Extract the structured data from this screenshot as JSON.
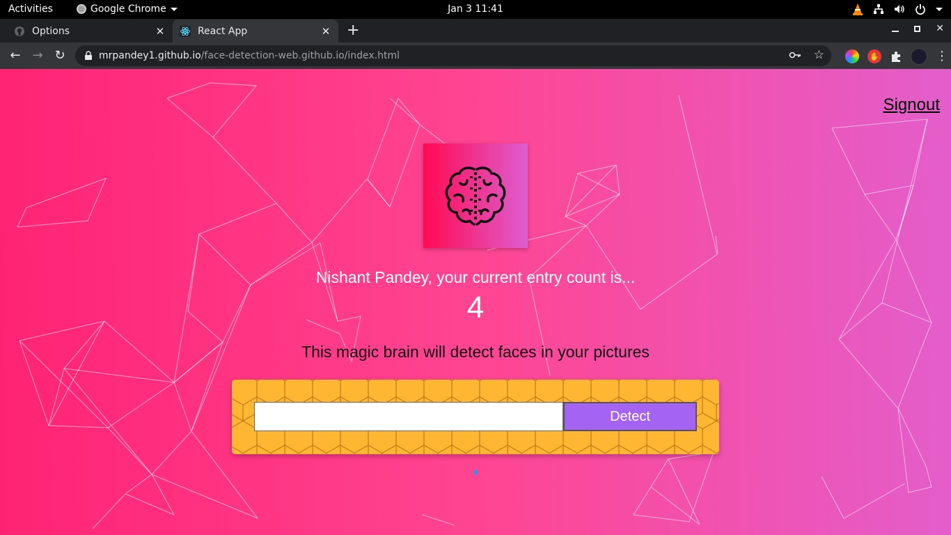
{
  "system_bar": {
    "activities": "Activities",
    "app_menu": "Google Chrome",
    "clock": "Jan 3  11:41",
    "tray_icons": [
      "vlc-icon",
      "network-icon",
      "volume-icon",
      "power-icon"
    ]
  },
  "browser": {
    "tabs": [
      {
        "title": "Options",
        "icon": "github-icon",
        "active": false
      },
      {
        "title": "React App",
        "icon": "react-icon",
        "active": true
      }
    ],
    "address": {
      "host": "mrpandey1.github.io",
      "path": "/face-detection-web.github.io/index.html"
    },
    "extensions": [
      "color-wheel-extension-icon",
      "stop-hand-extension-icon",
      "puzzle-extensions-icon"
    ]
  },
  "page": {
    "signout": "Signout",
    "entry_text": "Nishant Pandey, your current entry count is...",
    "entry_count": "4",
    "tagline": "This magic brain will detect faces in your pictures",
    "input_value": "",
    "detect_label": "Detect"
  },
  "colors": {
    "bg_left": "#ff2373",
    "bg_right": "#e35ecb",
    "button": "#a463f2",
    "honeycomb": "#ffb632"
  }
}
